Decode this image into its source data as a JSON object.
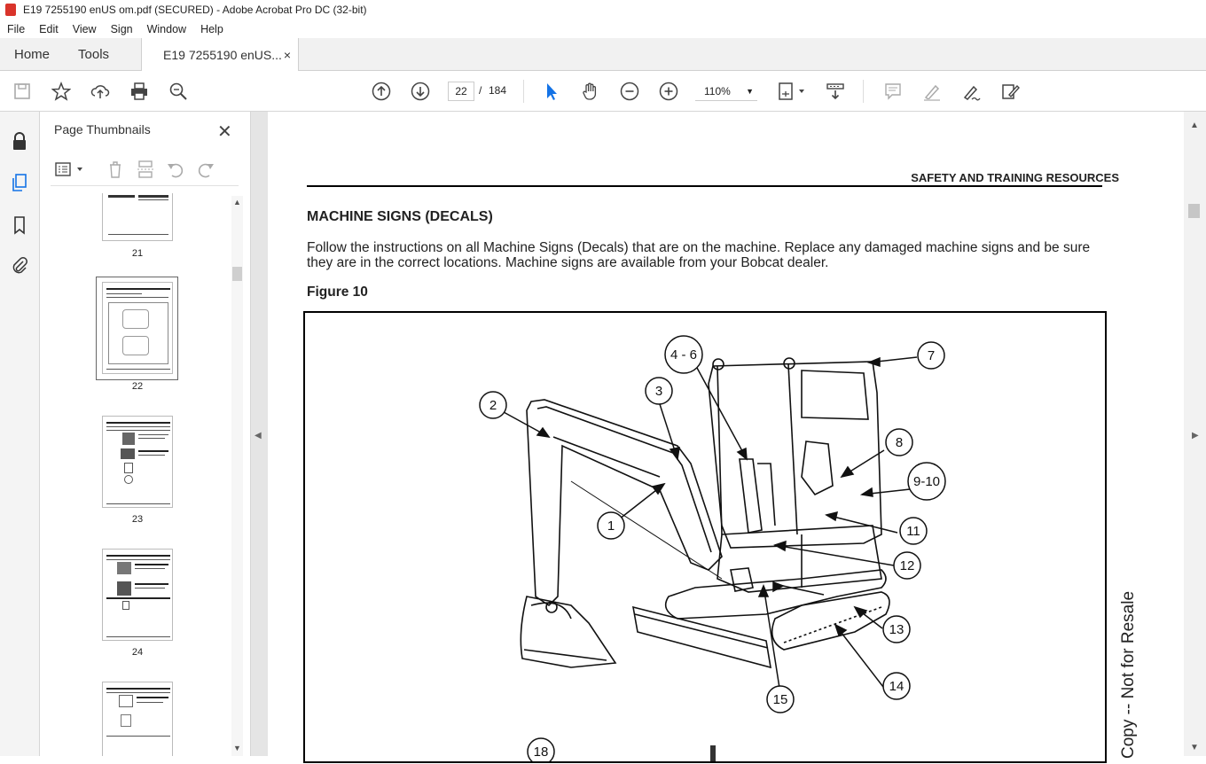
{
  "window": {
    "title": "E19 7255190 enUS om.pdf (SECURED) - Adobe Acrobat Pro DC (32-bit)"
  },
  "menu": [
    "File",
    "Edit",
    "View",
    "Sign",
    "Window",
    "Help"
  ],
  "tabs": {
    "home": "Home",
    "tools": "Tools",
    "doc": "E19 7255190 enUS...",
    "close": "×"
  },
  "toolbar": {
    "page_current": "22",
    "page_sep": "/",
    "page_total": "184",
    "zoom": "110%"
  },
  "thumb_panel": {
    "title": "Page Thumbnails",
    "pages": [
      "21",
      "22",
      "23",
      "24"
    ]
  },
  "document": {
    "header": "SAFETY AND TRAINING RESOURCES",
    "section_title": "MACHINE SIGNS (DECALS)",
    "paragraph": "Follow the instructions on all Machine Signs (Decals) that are on the machine. Replace any damaged machine signs and be sure they are in the correct locations. Machine signs are available from your Bobcat dealer.",
    "figure_label": "Figure 10",
    "watermark": "Copy -- Not for Resale",
    "callouts": [
      "1",
      "2",
      "3",
      "4 - 6",
      "7",
      "8",
      "9-10",
      "11",
      "12",
      "13",
      "14",
      "15",
      "18"
    ]
  }
}
